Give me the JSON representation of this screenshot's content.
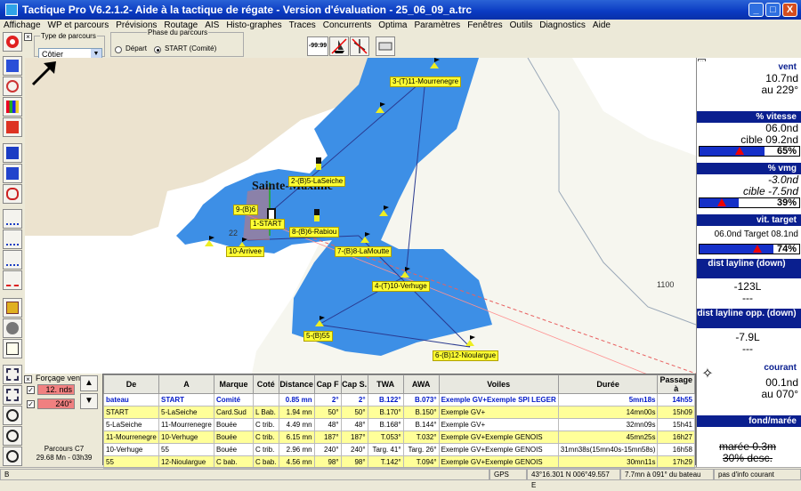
{
  "window": {
    "title": "Tactique Pro V6.2.1.2- Aide à la tactique de régate - Version d'évaluation - 25_06_09_a.trc",
    "min": "_",
    "max": "□",
    "close": "X"
  },
  "menu": [
    "Affichage",
    "WP et parcours",
    "Prévisions",
    "Routage",
    "AIS",
    "Histo-graphes",
    "Traces",
    "Concurrents",
    "Optima",
    "Paramètres",
    "Fenêtres",
    "Outils",
    "Diagnostics",
    "Aide"
  ],
  "parcours": {
    "group_label": "Type de parcours",
    "value": "Côtier"
  },
  "phase": {
    "group_label": "Phase du parcours",
    "opt1": "Départ",
    "opt2": "START (Comité)"
  },
  "toolbar": {
    "timer": "-99:99"
  },
  "map": {
    "place": "Sainte-Maxime",
    "depth1": "22",
    "depth2": "1100",
    "labels": [
      {
        "t": "3-(T)11-Mourrenegre"
      },
      {
        "t": "2-(B)5-LaSeiche"
      },
      {
        "t": "9-(B)6"
      },
      {
        "t": "1-START"
      },
      {
        "t": "8-(B)6-Rabiou"
      },
      {
        "t": "10-Arrivee"
      },
      {
        "t": "7-(B)8-LaMoutte"
      },
      {
        "t": "4-(T)10-Verhuge"
      },
      {
        "t": "5-(B)55"
      },
      {
        "t": "6-(B)12-Nioulargue"
      }
    ]
  },
  "right": {
    "vent": {
      "head": "vent",
      "v1": "10.7nd",
      "v2": "au 229°"
    },
    "vitesse": {
      "head": "% vitesse",
      "v1": "06.0nd",
      "v2": "cible 09.2nd",
      "pct": "65%",
      "fill": 0.65
    },
    "vmg": {
      "head": "% vmg",
      "v1": "-3.0nd",
      "v2": "cible -7.5nd",
      "pct": "39%",
      "fill": 0.39
    },
    "vtarget": {
      "head": "vit. target",
      "v1": "06.0nd",
      "v2": "Target 08.1nd",
      "pct": "74%",
      "fill": 0.74
    },
    "layline": {
      "head": "dist layline (down)",
      "v1": "-123L",
      "v2": "---"
    },
    "laylineopp": {
      "head": "dist layline opp. (down)",
      "v1": "-7.9L",
      "v2": "---"
    },
    "courant": {
      "head": "courant",
      "v1": "00.1nd",
      "v2": "au 070°"
    },
    "fond": {
      "head": "fond/marée",
      "v1": "marée 0.3m",
      "v2": "30% desc."
    }
  },
  "forcage": {
    "label": "Forçage vent",
    "speed": "12. nds",
    "dir": "240°"
  },
  "parcours_info": {
    "l1": "Parcours C7",
    "l2": "29.68 Mn - 03h39"
  },
  "table": {
    "headers": [
      "De",
      "A",
      "Marque",
      "Coté",
      "Distance",
      "Cap F",
      "Cap S.",
      "TWA",
      "AWA",
      "Voiles",
      "Durée",
      "Passage à"
    ],
    "rows": [
      [
        "bateau",
        "START",
        "Comité",
        "",
        "0.85 mn",
        "2°",
        "2°",
        "B.122°",
        "B.073°",
        "Exemple GV+Exemple SPI LEGER",
        "5mn18s",
        "14h55"
      ],
      [
        "START",
        "5-LaSeiche",
        "Card.Sud",
        "L Bab.",
        "1.94 mn",
        "50°",
        "50°",
        "B.170°",
        "B.150°",
        "Exemple GV+",
        "14mn00s",
        "15h09"
      ],
      [
        "5-LaSeiche",
        "11-Mourrenegre",
        "Bouée",
        "C trib.",
        "4.49 mn",
        "48°",
        "48°",
        "B.168°",
        "B.144°",
        "Exemple GV+",
        "32mn09s",
        "15h41"
      ],
      [
        "11-Mourrenegre",
        "10-Verhuge",
        "Bouée",
        "C trib.",
        "6.15 mn",
        "187°",
        "187°",
        "T.053°",
        "T.032°",
        "Exemple GV+Exemple GENOIS",
        "45mn25s",
        "16h27"
      ],
      [
        "10-Verhuge",
        "55",
        "Bouée",
        "C trib.",
        "2.96 mn",
        "240°",
        "240°",
        "Targ. 41°",
        "Targ. 26°",
        "Exemple GV+Exemple GENOIS",
        "31mn38s(15mn40s-15mn58s)",
        "16h58"
      ],
      [
        "55",
        "12-Nioulargue",
        "C bab.",
        "C bab.",
        "4.56 mn",
        "98°",
        "98°",
        "T.142°",
        "T.094°",
        "Exemple GV+Exemple GENOIS",
        "30mn11s",
        "17h29"
      ]
    ]
  },
  "status": {
    "s1": "B",
    "s2": "GPS",
    "s3": "43°16.301 N  006°49.557 E",
    "s4": "7.7mn à 091° du bateau",
    "s5": "pas d'info courant"
  }
}
